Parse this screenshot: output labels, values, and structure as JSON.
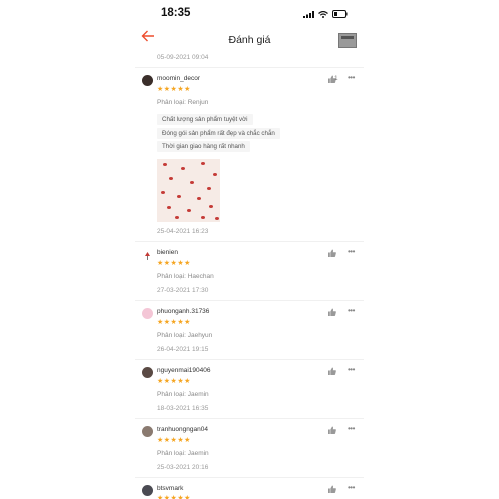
{
  "status": {
    "time": "18:35"
  },
  "nav": {
    "title": "Đánh giá",
    "back_icon": "arrow-left-icon",
    "thumbnail_icon": "product-thumbnail"
  },
  "previous": {
    "date": "05-09-2021 09:04"
  },
  "reviews": [
    {
      "user": "moomin_decor",
      "stars": "★★★★★",
      "variant": "Phân loại: Renjun",
      "tags": [
        "Chất lượng sản phẩm tuyệt vời",
        "Đóng gói sản phẩm rất đẹp và chắc chắn",
        "Thời gian giao hàng rất nhanh"
      ],
      "date": "25-04-2021 16:23",
      "likes": "1"
    },
    {
      "user": "bienien",
      "stars": "★★★★★",
      "variant": "Phân loại: Haechan",
      "date": "27-03-2021 17:30"
    },
    {
      "user": "phuonganh.31736",
      "stars": "★★★★★",
      "variant": "Phân loại: Jaehyun",
      "date": "26-04-2021 19:15"
    },
    {
      "user": "nguyenmai190406",
      "stars": "★★★★★",
      "variant": "Phân loại: Jaemin",
      "date": "18-03-2021 16:35"
    },
    {
      "user": "tranhuongngan04",
      "stars": "★★★★★",
      "variant": "Phân loại: Jaemin",
      "date": "25-03-2021 20:16"
    },
    {
      "user": "btsvmark",
      "stars": "★★★★★"
    }
  ],
  "icons": {
    "like": "thumbs-up-icon",
    "more": "more-options-icon",
    "star_color": "#f5a623",
    "accent": "#ee4d2d"
  }
}
